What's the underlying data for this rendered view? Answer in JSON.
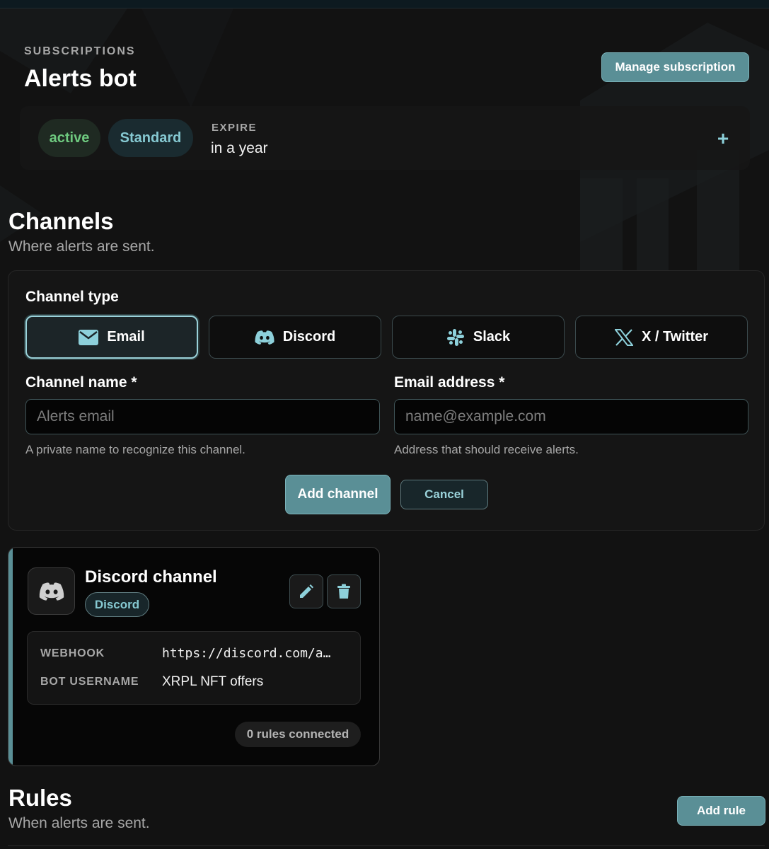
{
  "header": {
    "eyebrow": "SUBSCRIPTIONS",
    "title": "Alerts bot",
    "manage_label": "Manage subscription"
  },
  "status": {
    "state": "active",
    "plan": "Standard",
    "expire_label": "EXPIRE",
    "expire_value": "in a year",
    "plus": "+"
  },
  "channels_section": {
    "title": "Channels",
    "subtitle": "Where alerts are sent."
  },
  "form": {
    "type_label": "Channel type",
    "types": [
      {
        "label": "Email",
        "icon": "envelope-icon",
        "selected": true
      },
      {
        "label": "Discord",
        "icon": "discord-icon",
        "selected": false
      },
      {
        "label": "Slack",
        "icon": "slack-icon",
        "selected": false
      },
      {
        "label": "X / Twitter",
        "icon": "x-twitter-icon",
        "selected": false
      }
    ],
    "name_label": "Channel name *",
    "name_placeholder": "Alerts email",
    "name_value": "",
    "name_help": "A private name to recognize this channel.",
    "email_label": "Email address *",
    "email_placeholder": "name@example.com",
    "email_value": "",
    "email_help": "Address that should receive alerts.",
    "add_label": "Add channel",
    "cancel_label": "Cancel"
  },
  "channel_card": {
    "name": "Discord channel",
    "badge": "Discord",
    "webhook_key": "WEBHOOK",
    "webhook_value": "https://discord.com/a…",
    "username_key": "BOT USERNAME",
    "username_value": "XRPL NFT offers",
    "rules_connected": "0 rules connected"
  },
  "rules_section": {
    "title": "Rules",
    "subtitle": "When alerts are sent.",
    "add_label": "Add rule"
  },
  "colors": {
    "background": "#121212",
    "accent": "#5a8f96",
    "accent_text": "#86c9d2",
    "active_green": "#6ec97f"
  }
}
